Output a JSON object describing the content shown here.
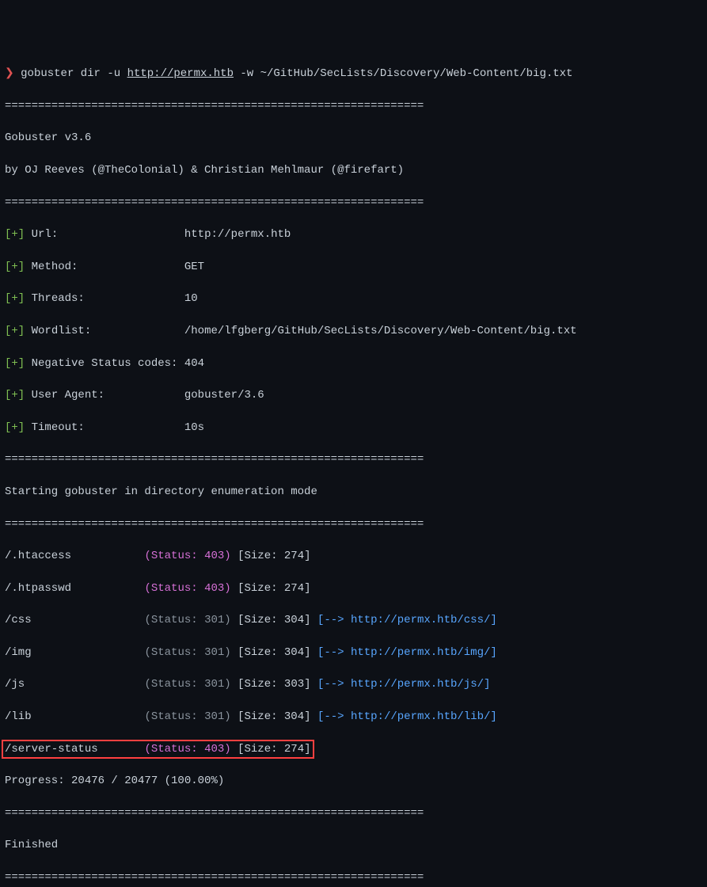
{
  "prompt": {
    "symbol": "❯",
    "command": "gobuster dir -u ",
    "url": "http://permx.htb",
    "args": " -w ~/GitHub/SecLists/Discovery/Web-Content/big.txt"
  },
  "separator": "===============================================================",
  "header": {
    "version": "Gobuster v3.6",
    "authors": "by OJ Reeves (@TheColonial) & Christian Mehlmaur (@firefart)"
  },
  "config": [
    {
      "label": "Url:",
      "value": "http://permx.htb"
    },
    {
      "label": "Method:",
      "value": "GET"
    },
    {
      "label": "Threads:",
      "value": "10"
    },
    {
      "label": "Wordlist:",
      "value": "/home/lfgberg/GitHub/SecLists/Discovery/Web-Content/big.txt"
    },
    {
      "label": "Negative Status codes:",
      "value": "404"
    },
    {
      "label": "User Agent:",
      "value": "gobuster/3.6"
    },
    {
      "label": "Timeout:",
      "value": "10s"
    }
  ],
  "starting": "Starting gobuster in directory enumeration mode",
  "results": [
    {
      "path": "/.htaccess",
      "status": "403",
      "size": "274",
      "redirect": null
    },
    {
      "path": "/.htpasswd",
      "status": "403",
      "size": "274",
      "redirect": null
    },
    {
      "path": "/css",
      "status": "301",
      "size": "304",
      "redirect": "http://permx.htb/css/"
    },
    {
      "path": "/img",
      "status": "301",
      "size": "304",
      "redirect": "http://permx.htb/img/"
    },
    {
      "path": "/js",
      "status": "301",
      "size": "303",
      "redirect": "http://permx.htb/js/"
    },
    {
      "path": "/lib",
      "status": "301",
      "size": "304",
      "redirect": "http://permx.htb/lib/"
    },
    {
      "path": "/server-status",
      "status": "403",
      "size": "274",
      "redirect": null,
      "highlighted": true
    }
  ],
  "progress": "Progress: 20476 / 20477 (100.00%)",
  "finished": "Finished"
}
